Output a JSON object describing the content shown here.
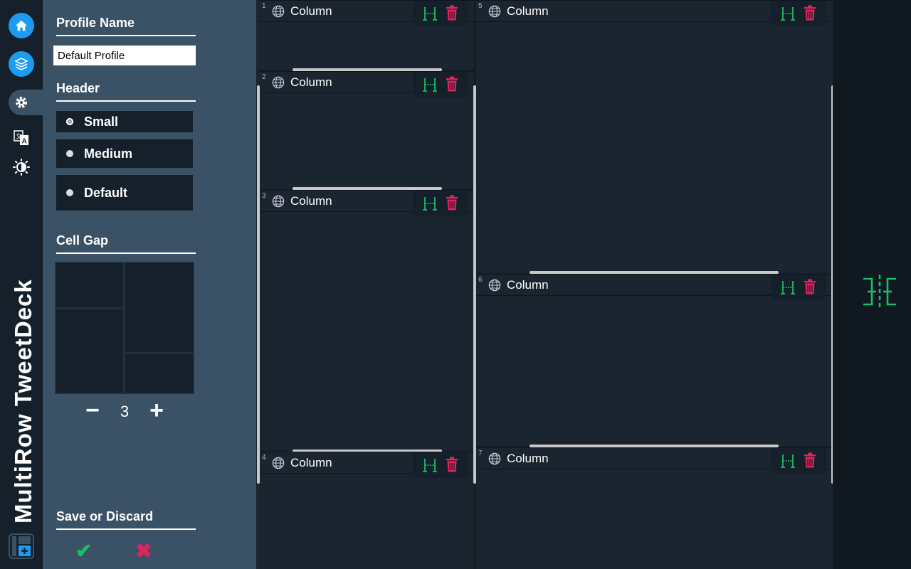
{
  "app": {
    "brand": "MultiRow TweetDeck"
  },
  "rail": {
    "items": [
      {
        "name": "home-icon"
      },
      {
        "name": "layers-icon"
      },
      {
        "name": "gear-icon"
      },
      {
        "name": "translate-icon"
      },
      {
        "name": "brightness-icon"
      }
    ],
    "add_icon": "add-column-layout-icon"
  },
  "panel": {
    "profile_label": "Profile Name",
    "profile_value": "Default Profile",
    "header_label": "Header",
    "header_options": [
      {
        "label": "Small",
        "selected": true
      },
      {
        "label": "Medium",
        "selected": false
      },
      {
        "label": "Default",
        "selected": false
      }
    ],
    "cellgap_label": "Cell Gap",
    "cellgap_value": "3",
    "minus": "−",
    "plus": "+",
    "save_label": "Save or Discard",
    "save_icon": "✔",
    "discard_icon": "✖"
  },
  "columns": [
    {
      "num": "1",
      "title": "Column"
    },
    {
      "num": "2",
      "title": "Column"
    },
    {
      "num": "3",
      "title": "Column"
    },
    {
      "num": "4",
      "title": "Column"
    },
    {
      "num": "5",
      "title": "Column"
    },
    {
      "num": "6",
      "title": "Column"
    },
    {
      "num": "7",
      "title": "Column"
    }
  ],
  "colors": {
    "accent_blue": "#1d9bf0",
    "green": "#17bf63",
    "red": "#e0245e",
    "panel": "#3b5266",
    "bg": "#15202b"
  }
}
